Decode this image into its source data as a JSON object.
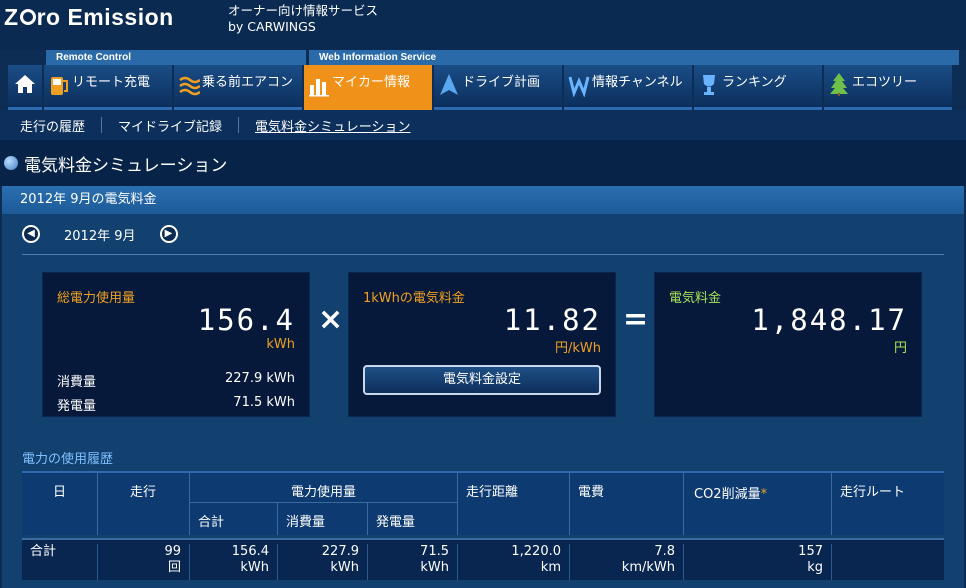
{
  "brand": {
    "logo_text": "ZeRo Emission",
    "subtitle_line1": "オーナー向け情報サービス",
    "subtitle_line2": "by CARWINGS"
  },
  "nav_groups": {
    "remote": "Remote Control",
    "web": "Web Information Service"
  },
  "nav": {
    "home_icon": "home-icon",
    "items": [
      {
        "label": "リモート充電",
        "icon": "charge-plug-icon"
      },
      {
        "label": "乗る前エアコン",
        "icon": "aircon-waves-icon"
      },
      {
        "label": "マイカー情報",
        "icon": "bar-chart-icon",
        "active": true
      },
      {
        "label": "ドライブ計画",
        "icon": "navigation-arrow-icon"
      },
      {
        "label": "情報チャンネル",
        "icon": "channel-w-icon"
      },
      {
        "label": "ランキング",
        "icon": "trophy-icon"
      },
      {
        "label": "エコツリー",
        "icon": "tree-icon"
      }
    ]
  },
  "subnav": {
    "items": [
      "走行の履歴",
      "マイドライブ記録",
      "電気料金シミュレーション"
    ]
  },
  "page": {
    "title": "電気料金シミュレーション",
    "panel_header": "2012年 9月の電気料金",
    "month_label": "2012年 9月"
  },
  "boxes": {
    "total": {
      "label": "総電力使用量",
      "value": "156.4",
      "unit": "kWh",
      "consumption_label": "消費量",
      "consumption_value": "227.9 kWh",
      "generation_label": "発電量",
      "generation_value": "71.5 kWh"
    },
    "rate": {
      "label": "1kWhの電気料金",
      "value": "11.82",
      "unit": "円/kWh",
      "button": "電気料金設定"
    },
    "cost": {
      "label": "電気料金",
      "value": "1,848.17",
      "unit": "円"
    },
    "op_multiply": "×",
    "op_equals": "="
  },
  "history": {
    "tab": "電力の使用履歴",
    "headers": {
      "day": "日",
      "trips": "走行",
      "power": "電力使用量",
      "total": "合計",
      "consumption": "消費量",
      "generation": "発電量",
      "distance": "走行距離",
      "efficiency": "電費",
      "co2": "CO2削減量",
      "co2_star": "*",
      "route": "走行ルート"
    },
    "total_row": {
      "label": "合計",
      "trips": "99",
      "trips_unit": "回",
      "total": "156.4",
      "total_unit": "kWh",
      "consumption": "227.9",
      "consumption_unit": "kWh",
      "generation": "71.5",
      "generation_unit": "kWh",
      "distance": "1,220.0",
      "distance_unit": "km",
      "efficiency": "7.8",
      "efficiency_unit": "km/kWh",
      "co2": "157",
      "co2_unit": "kg"
    }
  }
}
